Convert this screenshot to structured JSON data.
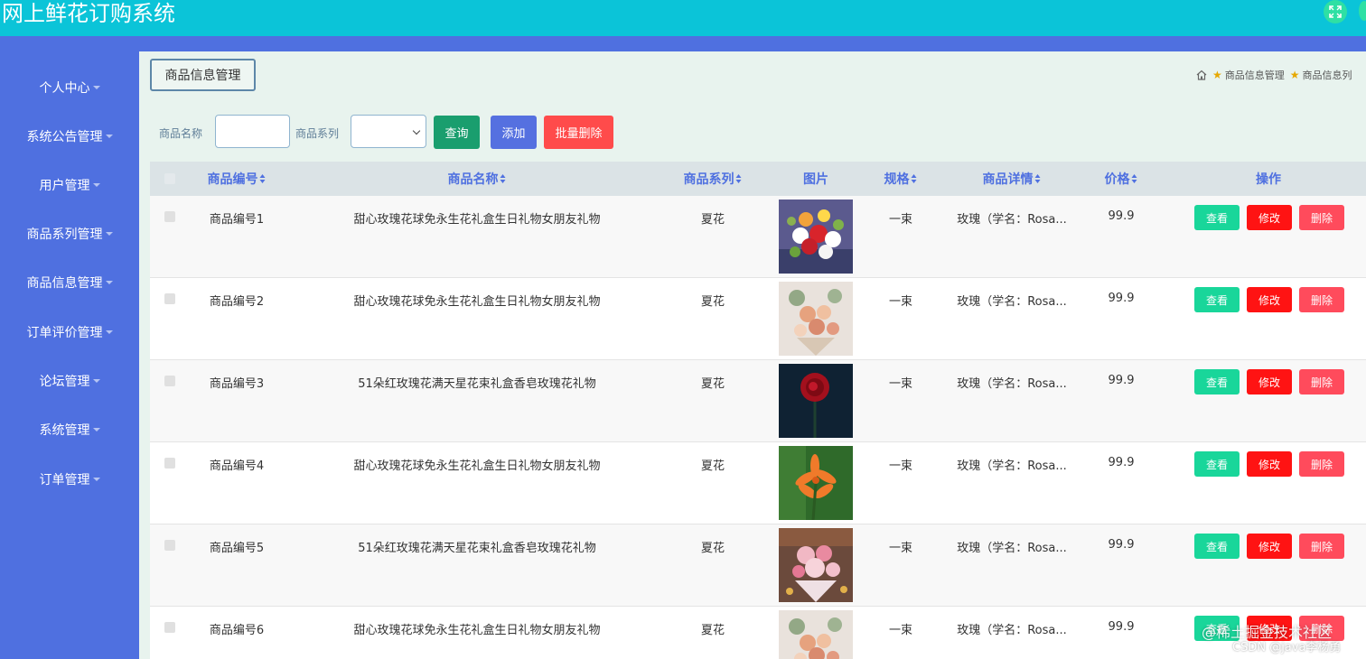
{
  "app": {
    "title": "网上鲜花订购系统"
  },
  "sidebar": {
    "items": [
      {
        "label": "个人中心"
      },
      {
        "label": "系统公告管理"
      },
      {
        "label": "用户管理"
      },
      {
        "label": "商品系列管理"
      },
      {
        "label": "商品信息管理"
      },
      {
        "label": "订单评价管理"
      },
      {
        "label": "论坛管理"
      },
      {
        "label": "系统管理"
      },
      {
        "label": "订单管理"
      }
    ]
  },
  "page": {
    "tag": "商品信息管理",
    "breadcrumb": [
      "商品信息管理",
      "商品信息列"
    ]
  },
  "search": {
    "name_label": "商品名称",
    "name_value": "",
    "series_label": "商品系列",
    "series_value": "",
    "query_label": "查询",
    "add_label": "添加",
    "batch_delete_label": "批量删除"
  },
  "colors": {
    "topbar": "#0bc4d8",
    "sidebar": "#4f70e0",
    "header_text": "#4f70e0",
    "query": "#1a9e6e",
    "add": "#5570e0",
    "batch_delete": "#ff4b4b",
    "view": "#19d69a",
    "edit": "#ff1313",
    "delete": "#ff4b5c"
  },
  "table": {
    "columns": [
      "商品编号",
      "商品名称",
      "商品系列",
      "图片",
      "规格",
      "商品详情",
      "价格",
      "操作"
    ],
    "actions": {
      "view": "查看",
      "edit": "修改",
      "delete": "删除"
    },
    "rows": [
      {
        "id": "商品编号1",
        "name": "甜心玫瑰花球免永生花礼盒生日礼物女朋友礼物",
        "series": "夏花",
        "image": "bouquet-red-white",
        "spec": "一束",
        "detail": "玫瑰（学名：Rosa...",
        "price": "99.9"
      },
      {
        "id": "商品编号2",
        "name": "甜心玫瑰花球免永生花礼盒生日礼物女朋友礼物",
        "series": "夏花",
        "image": "bouquet-peach-eucalyptus",
        "spec": "一束",
        "detail": "玫瑰（学名：Rosa...",
        "price": "99.9"
      },
      {
        "id": "商品编号3",
        "name": "51朵红玫瑰花满天星花束礼盒香皂玫瑰花礼物",
        "series": "夏花",
        "image": "single-red-rose",
        "spec": "一束",
        "detail": "玫瑰（学名：Rosa...",
        "price": "99.9"
      },
      {
        "id": "商品编号4",
        "name": "甜心玫瑰花球免永生花礼盒生日礼物女朋友礼物",
        "series": "夏花",
        "image": "orange-lily",
        "spec": "一束",
        "detail": "玫瑰（学名：Rosa...",
        "price": "99.9"
      },
      {
        "id": "商品编号5",
        "name": "51朵红玫瑰花满天星花束礼盒香皂玫瑰花礼物",
        "series": "夏花",
        "image": "bouquet-pink",
        "spec": "一束",
        "detail": "玫瑰（学名：Rosa...",
        "price": "99.9"
      },
      {
        "id": "商品编号6",
        "name": "甜心玫瑰花球免永生花礼盒生日礼物女朋友礼物",
        "series": "夏花",
        "image": "bouquet-peach-eucalyptus",
        "spec": "一束",
        "detail": "玫瑰（学名：Rosa...",
        "price": "99.9"
      }
    ]
  },
  "watermark": {
    "line1": "@稀土掘金技术社区",
    "line2": "CSDN @java李杨勇"
  }
}
